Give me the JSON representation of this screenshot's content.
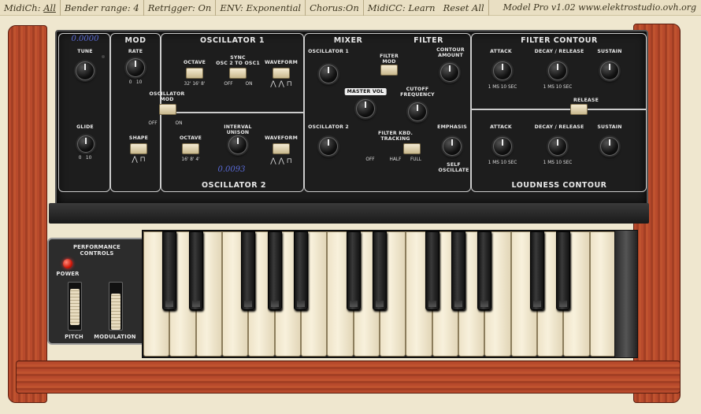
{
  "topbar": {
    "midich_label": "MidiCh:",
    "midich_value": "All",
    "bender_label": "Bender range:",
    "bender_value": "4",
    "retrigger": "Retrigger: On",
    "env": "ENV:  Exponential",
    "chorus": "Chorus:On",
    "midicc": "MidiCC:  Learn",
    "reset": "Reset All",
    "title": "Model Pro v1.02   www.elektrostudio.ovh.org"
  },
  "panel": {
    "tune_readout": "0.0000",
    "tune": "TUNE",
    "glide": "GLIDE",
    "mod": "MOD",
    "rate": "RATE",
    "osc_mod": "OSCILLATOR\nMOD",
    "off": "OFF",
    "on": "ON",
    "shape": "SHAPE",
    "osc1": "OSCILLATOR 1",
    "octave": "OCTAVE",
    "sync": "SYNC\nOSC 2 TO OSC1",
    "waveform": "WAVEFORM",
    "oct_scale": "32'  16'  8'",
    "osc2": "OSCILLATOR 2",
    "interval": "INTERVAL\nUNISON",
    "osc2_readout": "0.0093",
    "oct2_scale": "16'  8'  4'",
    "mixer": "MIXER",
    "mix_osc1": "OSCILLATOR 1",
    "mix_osc2": "OSCILLATOR 2",
    "master_vol": "MASTER VOL",
    "filter_mod": "FILTER\nMOD",
    "filter": "FILTER",
    "contour_amount": "CONTOUR\nAMOUNT",
    "cutoff": "CUTOFF\nFREQUENCY",
    "emphasis": "EMPHASIS",
    "self_osc": "SELF\nOSCILLATE",
    "kbd_tracking": "FILTER KBD.\nTRACKING",
    "off2": "OFF",
    "half": "HALF",
    "full": "FULL",
    "filter_contour": "FILTER CONTOUR",
    "attack": "ATTACK",
    "decay_release": "DECAY / RELEASE",
    "sustain": "SUSTAIN",
    "release": "RELEASE",
    "loudness_contour": "LOUDNESS CONTOUR",
    "time_scale": "1 MS   10 SEC"
  },
  "perf": {
    "title": "PERFORMANCE\nCONTROLS",
    "power": "POWER",
    "pitch": "PITCH",
    "modulation": "MODULATION"
  }
}
